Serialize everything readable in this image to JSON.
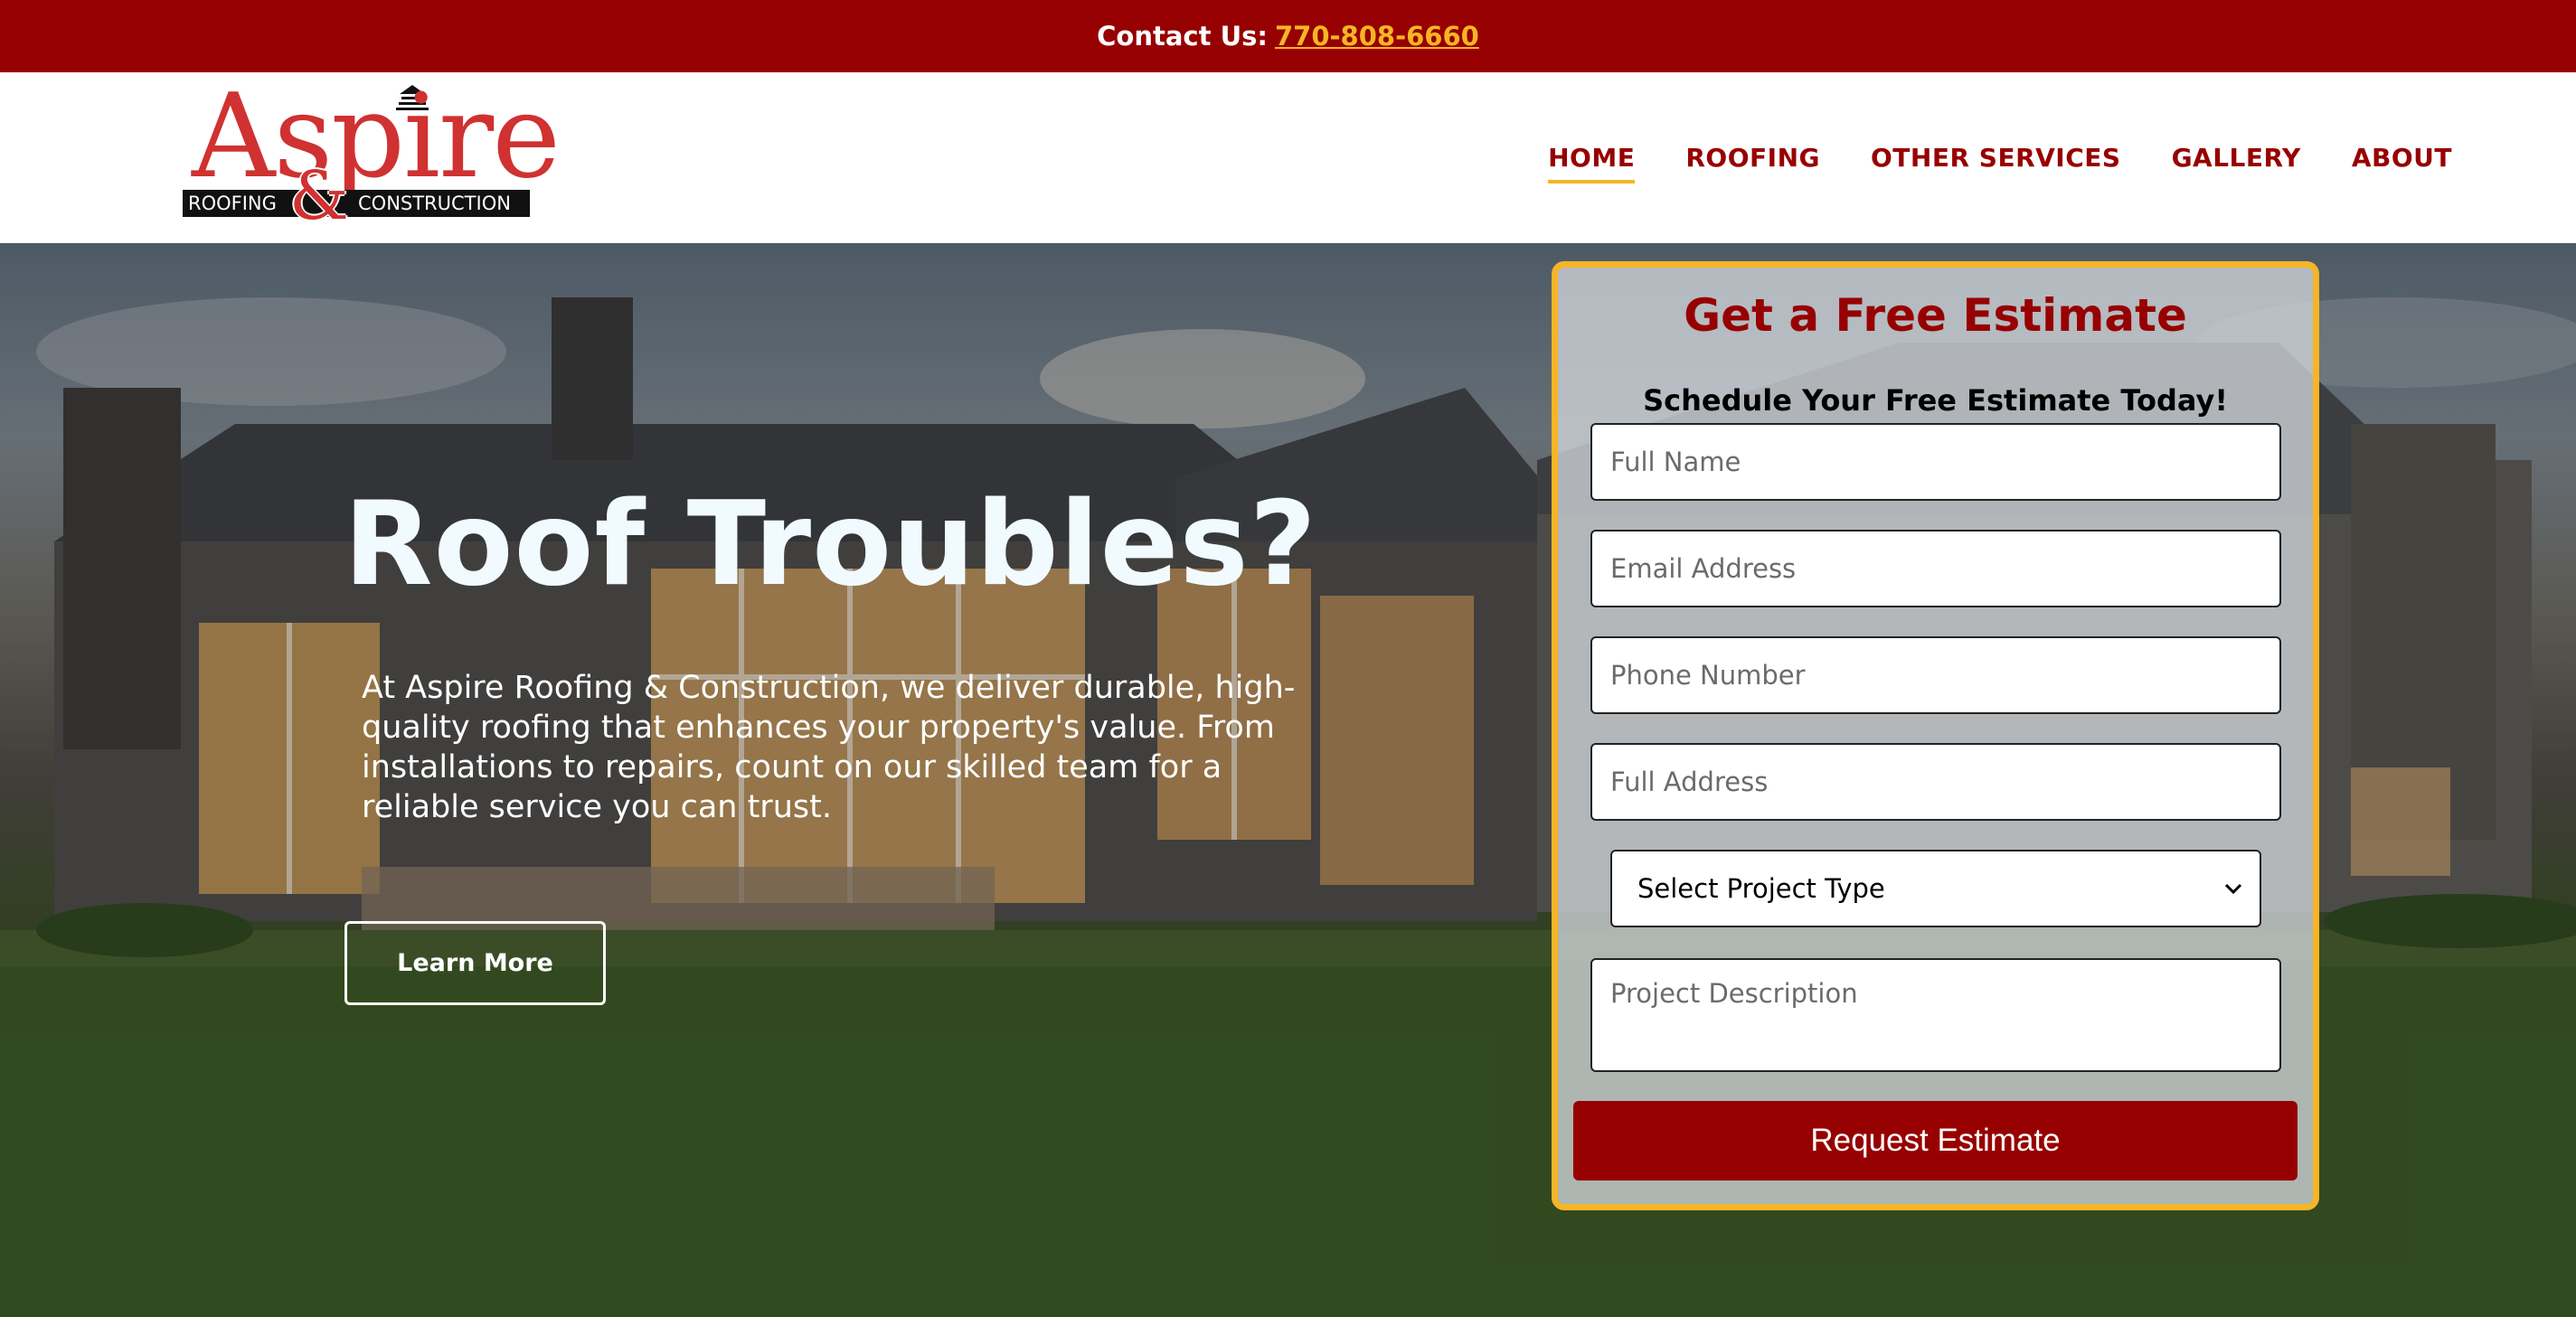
{
  "topbar": {
    "label": "Contact Us:",
    "phone": "770-808-6660"
  },
  "logo": {
    "word": "Aspire",
    "left_text": "ROOFING",
    "ampersand": "&",
    "right_text": "CONSTRUCTION"
  },
  "nav": {
    "items": [
      {
        "label": "HOME",
        "active": true
      },
      {
        "label": "ROOFING",
        "active": false
      },
      {
        "label": "OTHER SERVICES",
        "active": false
      },
      {
        "label": "GALLERY",
        "active": false
      },
      {
        "label": "ABOUT",
        "active": false
      }
    ]
  },
  "hero": {
    "title": "Roof Troubles?",
    "text": "At Aspire Roofing & Construction, we deliver durable, high-quality roofing that enhances your property's value. From installations to repairs, count on our skilled team for a reliable service you can trust.",
    "button": "Learn More"
  },
  "form": {
    "title": "Get a Free Estimate",
    "subtitle": "Schedule Your Free Estimate Today!",
    "full_name_placeholder": "Full Name",
    "email_placeholder": "Email Address",
    "phone_placeholder": "Phone Number",
    "address_placeholder": "Full Address",
    "select_value": "Select Project Type",
    "description_placeholder": "Project Description",
    "submit": "Request Estimate"
  },
  "colors": {
    "brand_red": "#970000",
    "accent_gold": "#f5b526",
    "logo_red": "#d03131"
  }
}
